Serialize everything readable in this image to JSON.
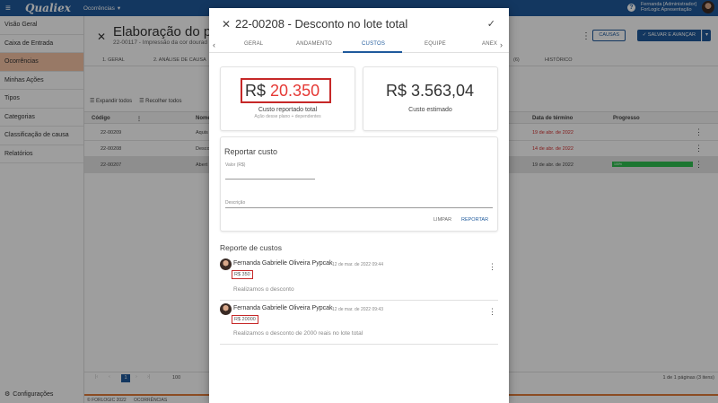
{
  "topbar": {
    "app_name": "Qualiex",
    "module": "Ocorrências",
    "user_name": "Fernanda [Administrador]",
    "user_org": "ForLogic Apresentação"
  },
  "sidebar": {
    "items": [
      {
        "label": "Visão Geral"
      },
      {
        "label": "Caixa de Entrada"
      },
      {
        "label": "Ocorrências"
      },
      {
        "label": "Minhas Ações"
      },
      {
        "label": "Tipos"
      },
      {
        "label": "Categorias"
      },
      {
        "label": "Classificação de causa"
      },
      {
        "label": "Relatórios"
      }
    ],
    "config_label": "Configurações"
  },
  "main": {
    "title": "Elaboração do pla",
    "subtitle": "22-00117 - Impressão da cor dourad",
    "tabs": [
      "1. GERAL",
      "2. ANÁLISE DE CAUSA",
      "(6)",
      "HISTÓRICO"
    ],
    "btn_causas": "CAUSAS",
    "btn_save": "SALVAR E AVANÇAR",
    "expand_all": "Expandir todos",
    "collapse_all": "Recolher todos",
    "columns": {
      "code": "Código",
      "name": "Nome",
      "end_date": "Data de término",
      "progress": "Progresso"
    },
    "rows": [
      {
        "code": "22-00209",
        "name": "Aquis",
        "date": "19 de abr. de 2022",
        "progress": ""
      },
      {
        "code": "22-00208",
        "name": "Desco",
        "date": "14 de abr. de 2022",
        "progress": ""
      },
      {
        "code": "22-00207",
        "name": "Abert",
        "date": "19 de abr. de 2022",
        "progress": "100%"
      }
    ],
    "page_number": "1",
    "page_size": "100",
    "pager_info": "1 de 1 páginas (3 itens)",
    "footer_left": "© FORLOGIC 2022",
    "footer_module": "OCORRÊNCIAS"
  },
  "modal": {
    "title": "22-00208 - Desconto no lote total",
    "tabs": [
      "GERAL",
      "ANDAMENTO",
      "CUSTOS",
      "EQUIPE",
      "ANEX"
    ],
    "active_tab": "CUSTOS",
    "reported_currency": "R$",
    "reported_value": "20.350",
    "reported_label": "Custo reportado total",
    "reported_sub": "Ação desse plano + dependentes",
    "estimated_value": "R$ 3.563,04",
    "estimated_label": "Custo estimado",
    "report_title": "Reportar custo",
    "value_label": "Valor (R$)",
    "description_label": "Descrição",
    "btn_clear": "LIMPAR",
    "btn_report": "REPORTAR",
    "cost_report_title": "Reporte de custos",
    "entries": [
      {
        "name": "Fernanda Gabrielle Oliveira Pypcak",
        "date": "12 de mar. de 2022 09:44",
        "amount": "R$ 350",
        "description": "Realizamos o desconto"
      },
      {
        "name": "Fernanda Gabrielle Oliveira Pypcak",
        "date": "12 de mar. de 2022 09:43",
        "amount": "R$ 20000",
        "description": "Realizamos o desconto de 2000 reais no lote total"
      }
    ]
  },
  "colors": {
    "brand": "#1f5a9c",
    "highlight": "#c62828",
    "active_sidebar": "#f5c3a5",
    "accent_orange": "#e07b39",
    "progress_green": "#2fbf4f"
  }
}
